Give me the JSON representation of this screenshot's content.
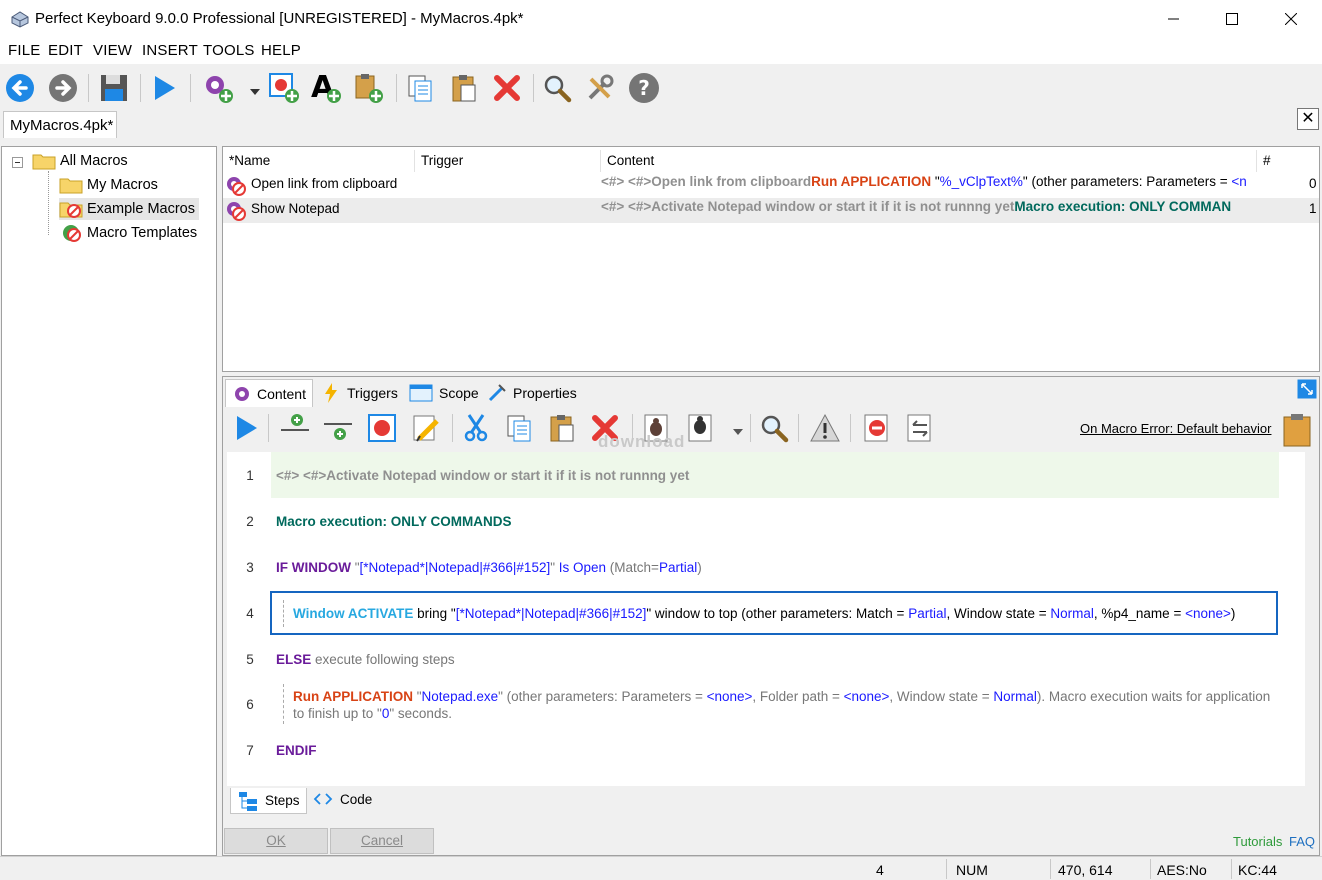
{
  "window": {
    "title": "Perfect Keyboard 9.0.0 Professional [UNREGISTERED] - MyMacros.4pk*"
  },
  "menu": [
    "FILE",
    "EDIT",
    "VIEW",
    "INSERT",
    "TOOLS",
    "HELP"
  ],
  "doc_tab": "MyMacros.4pk*",
  "tree": {
    "root": "All Macros",
    "children": [
      "My Macros",
      "Example Macros",
      "Macro Templates"
    ]
  },
  "list": {
    "columns": [
      "*Name",
      "Trigger",
      "Content",
      "#"
    ],
    "rows": [
      {
        "name": "Open link from clipboard",
        "trigger": "",
        "content_comment": "<#> <#>Open link from clipboard",
        "content_cmd": "Run APPLICATION",
        "content_q1": " \"",
        "content_val": "%_vClpText%",
        "content_rest": "\" (other parameters: Parameters = ",
        "content_val2": "<n",
        "count": "0"
      },
      {
        "name": "Show Notepad",
        "trigger": "",
        "content_comment": "<#> <#>Activate Notepad window or start it if it is not runnng yet",
        "content_cmd": "Macro execution: ONLY COMMAN",
        "count": "1"
      }
    ]
  },
  "panel_tabs": [
    "Content",
    "Triggers",
    "Scope",
    "Properties"
  ],
  "on_error": "On Macro Error: Default behavior",
  "watermark": "download",
  "steps": [
    {
      "n": "1",
      "comment": "<#> <#>Activate Notepad window or start it if it is not runnng yet"
    },
    {
      "n": "2",
      "kw": "Macro execution:",
      "val": " ONLY COMMANDS"
    },
    {
      "n": "3",
      "kw": "IF WINDOW",
      "q1": " \"",
      "target": "[*Notepad*|Notepad|#366|#152]",
      "q2": "\" ",
      "cond": "Is Open",
      "match_pre": " (Match=",
      "match": "Partial",
      "match_post": ")"
    },
    {
      "n": "4",
      "kw": "Window ACTIVATE",
      "text1": " bring \"",
      "target": "[*Notepad*|Notepad|#366|#152]",
      "text2": "\" window to top (other parameters: Match = ",
      "match": "Partial",
      "text3": ", Window state = ",
      "state": "Normal",
      "text4": ", %p4_name = ",
      "p4": "<none>",
      "text5": ")"
    },
    {
      "n": "5",
      "kw": "ELSE",
      "text": " execute following steps"
    },
    {
      "n": "6",
      "kw": "Run APPLICATION",
      "q1": " \"",
      "app": "Notepad.exe",
      "text1": "\" (other parameters: Parameters = ",
      "params": "<none>",
      "text2": ", Folder path = ",
      "folder": "<none>",
      "text3": ", Window state = ",
      "state": "Normal",
      "text4": "). Macro execution waits for application",
      "line2a": "to finish up to \"",
      "secs": "0",
      "line2b": "\" seconds."
    },
    {
      "n": "7",
      "kw": "ENDIF"
    }
  ],
  "bottom_tabs": [
    "Steps",
    "Code"
  ],
  "buttons": {
    "ok": "OK",
    "cancel": "Cancel"
  },
  "links": {
    "tutorials": "Tutorials",
    "faq": "FAQ"
  },
  "status": {
    "count": "4",
    "num": "NUM",
    "coords": "470, 614",
    "aes": "AES:No",
    "kc": "KC:44"
  },
  "colors": {
    "keyword_purple": "#6a1b9a",
    "keyword_teal": "#00695c",
    "keyword_orange": "#d84315",
    "keyword_cyan": "#27a8e0",
    "value_blue": "#1a1aff",
    "selection_border": "#1565c0",
    "comment_bg": "#eef8ea"
  }
}
